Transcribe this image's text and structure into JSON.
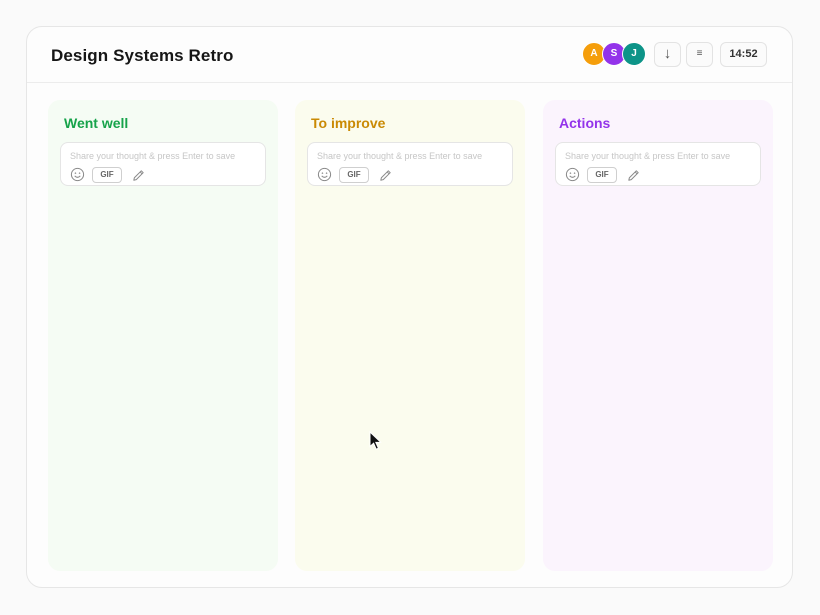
{
  "header": {
    "title": "Design Systems Retro",
    "avatars": [
      {
        "initial": "A",
        "color": "#f59e0b"
      },
      {
        "initial": "S",
        "color": "#9333ea"
      },
      {
        "initial": "J",
        "color": "#0d9488"
      }
    ],
    "download_glyph": "↓",
    "menu_glyph": "≡",
    "timer": "14:52"
  },
  "columns": [
    {
      "title": "Went well",
      "title_color": "#16a34a",
      "bg_color": "#f5fcf4",
      "placeholder": "Share your thought & press Enter to save",
      "gif_label": "GIF"
    },
    {
      "title": "To improve",
      "title_color": "#ca8a04",
      "bg_color": "#fbfcee",
      "placeholder": "Share your thought & press Enter to save",
      "gif_label": "GIF"
    },
    {
      "title": "Actions",
      "title_color": "#9333ea",
      "bg_color": "#fbf4fd",
      "placeholder": "Share your thought & press Enter to save",
      "gif_label": "GIF"
    }
  ],
  "icons": {
    "download": "download-icon",
    "menu": "menu-icon",
    "emoji": "emoji-icon",
    "pencil": "pencil-icon",
    "cursor": "mouse-cursor-icon"
  }
}
